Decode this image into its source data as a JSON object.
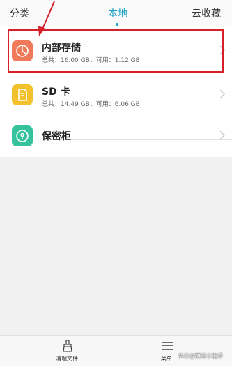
{
  "tabs": {
    "category": "分类",
    "local": "本地",
    "favorites": "云收藏"
  },
  "storage": [
    {
      "title": "内部存储",
      "subtitle": "总共：16.00 GB，可用：1.12 GB",
      "icon": "pie-chart-icon"
    },
    {
      "title": "SD 卡",
      "subtitle": "总共：14.49 GB，可用：6.06 GB",
      "icon": "sd-card-icon"
    },
    {
      "title": "保密柜",
      "icon": "lock-icon"
    }
  ],
  "bottom_bar": {
    "clean_label": "清理文件",
    "menu_label": "菜单"
  },
  "watermark": "头条@悟空小能手",
  "colors": {
    "accent": "#1aa0c4",
    "internal_icon": "#f07a59",
    "sd_icon": "#f4c12e",
    "safe_icon": "#36c29c",
    "highlight": "#d6202a"
  }
}
